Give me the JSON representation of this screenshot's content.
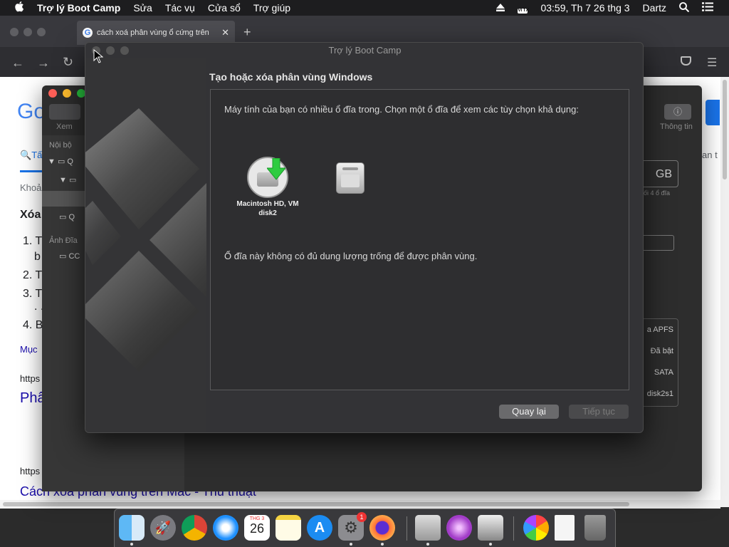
{
  "menubar": {
    "apple_icon": "",
    "app_name": "Trợ lý Boot Camp",
    "items": [
      "Sửa",
      "Tác vụ",
      "Cửa sổ",
      "Trợ giúp"
    ],
    "input_badge": "VI TX",
    "clock": "03:59, Th 7 26 thg 3",
    "user": "Dartz"
  },
  "browser": {
    "tab_title": "cách xoá phân vùng ổ cứng trên",
    "page_texts": {
      "google_logo": "Go",
      "tab_all": "Tấ",
      "crumb": "Khoả",
      "heading": "Xóa",
      "list": [
        "1. T",
        "b",
        "2. T",
        "3. T",
        ". .",
        "4. B"
      ],
      "more": "Mục",
      "https1": "https",
      "link1": "Phâ",
      "https2": "https",
      "link2": "Cách xóa phân vùng trên Mac - Thủ thuật",
      "right_tab": "an t"
    }
  },
  "disk_utility": {
    "toolbar_view": "Xem",
    "toolbar_info": "Thông tin",
    "section_internal": "Nội bộ",
    "section_images": "Ảnh Đĩa",
    "rows": [
      "Q",
      "Q",
      "CC"
    ],
    "capacity": "GB",
    "capacity_sub": "ối 4 ổ đĩa",
    "detail_rows": [
      "a APFS",
      "Đã bật",
      "SATA",
      "disk2s1"
    ]
  },
  "bootcamp": {
    "window_title": "Trợ lý Boot Camp",
    "heading": "Tạo hoặc xóa phân vùng Windows",
    "instruction": "Máy tính của bạn có nhiều ổ đĩa trong. Chọn một ổ đĩa để xem các tùy chọn khả dụng:",
    "disk1_label": "Macintosh HD, VM disk2",
    "message": "Ổ đĩa này không có đủ dung lượng trống để được phân vùng.",
    "back_button": "Quay lại",
    "continue_button": "Tiếp tục"
  },
  "dock": {
    "calendar_month": "THG 3",
    "calendar_day": "26",
    "badge": "1"
  },
  "colors": {
    "accent_blue": "#1a73e8",
    "traffic_red": "#ff5f57",
    "traffic_yellow": "#febc2e",
    "traffic_green": "#28c840"
  }
}
